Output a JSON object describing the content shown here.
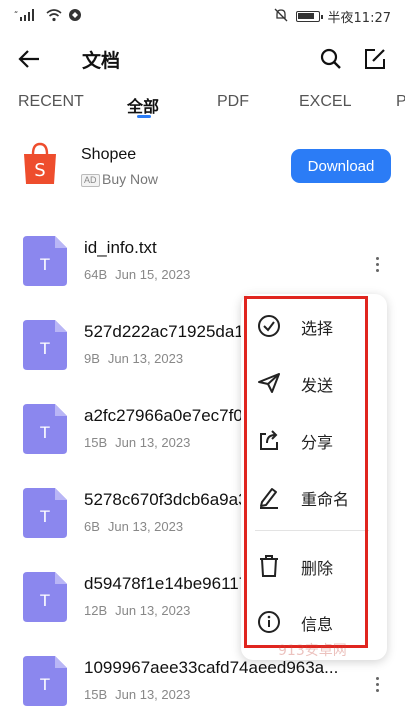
{
  "status_bar": {
    "time": "半夜11:27",
    "battery_level": 0.85
  },
  "header": {
    "title": "文档"
  },
  "tabs": [
    {
      "label": "RECENT"
    },
    {
      "label": "全部",
      "active": true
    },
    {
      "label": "PDF"
    },
    {
      "label": "EXCEL"
    },
    {
      "label": "P"
    }
  ],
  "ad": {
    "title": "Shopee",
    "badge": "AD",
    "subtitle": "Buy Now",
    "button_label": "Download",
    "brand_color": "#ee4d2d"
  },
  "files": [
    {
      "name": "id_info.txt",
      "size": "64B",
      "date": "Jun 15, 2023",
      "icon_letter": "T"
    },
    {
      "name": "527d222ac71925da1",
      "size": "9B",
      "date": "Jun 13, 2023",
      "icon_letter": "T"
    },
    {
      "name": "a2fc27966a0e7ec7f0",
      "size": "15B",
      "date": "Jun 13, 2023",
      "icon_letter": "T"
    },
    {
      "name": "5278c670f3dcb6a9a3",
      "size": "6B",
      "date": "Jun 13, 2023",
      "icon_letter": "T"
    },
    {
      "name": "d59478f1e14be96117",
      "size": "12B",
      "date": "Jun 13, 2023",
      "icon_letter": "T"
    },
    {
      "name": "1099967aee33cafd74aeed963a...",
      "size": "15B",
      "date": "Jun 13, 2023",
      "icon_letter": "T"
    }
  ],
  "context_menu": {
    "items": [
      {
        "label": "选择",
        "icon": "check-circle-icon"
      },
      {
        "label": "发送",
        "icon": "send-icon"
      },
      {
        "label": "分享",
        "icon": "share-icon"
      },
      {
        "label": "重命名",
        "icon": "pencil-icon"
      },
      {
        "label": "删除",
        "icon": "trash-icon"
      },
      {
        "label": "信息",
        "icon": "info-icon"
      }
    ]
  },
  "colors": {
    "accent": "#2b7cf6",
    "file_icon": "#8b87ee",
    "highlight_border": "#e0251f"
  },
  "watermark": "913安卓网"
}
